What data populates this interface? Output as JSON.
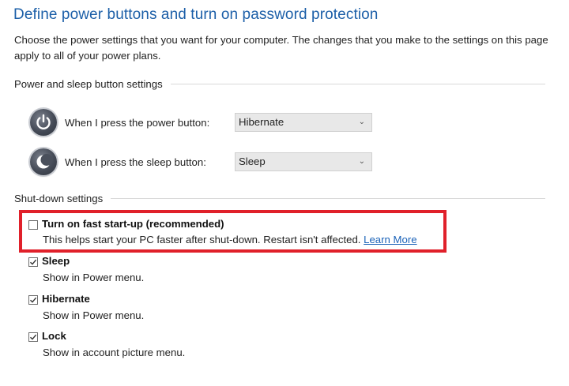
{
  "page": {
    "title": "Define power buttons and turn on password protection",
    "description": "Choose the power settings that you want for your computer. The changes that you make to the settings on this page apply to all of your power plans."
  },
  "power_sleep": {
    "header": "Power and sleep button settings",
    "power_button": {
      "label": "When I press the power button:",
      "value": "Hibernate"
    },
    "sleep_button": {
      "label": "When I press the sleep button:",
      "value": "Sleep"
    }
  },
  "shutdown": {
    "header": "Shut-down settings",
    "fast_startup": {
      "title": "Turn on fast start-up (recommended)",
      "description": "This helps start your PC faster after shut-down. Restart isn't affected.",
      "link": "Learn More",
      "checked": false
    },
    "sleep": {
      "title": "Sleep",
      "description": "Show in Power menu.",
      "checked": true
    },
    "hibernate": {
      "title": "Hibernate",
      "description": "Show in Power menu.",
      "checked": true
    },
    "lock": {
      "title": "Lock",
      "description": "Show in account picture menu.",
      "checked": true
    }
  },
  "colors": {
    "title_blue": "#1c5fa8",
    "link_blue": "#1a62b8",
    "highlight_red": "#e0202a"
  },
  "icons": {
    "power_button": "power-icon",
    "sleep_button": "moon-icon",
    "dropdown": "chevron-down-icon",
    "checkmark": "checkmark-icon"
  }
}
